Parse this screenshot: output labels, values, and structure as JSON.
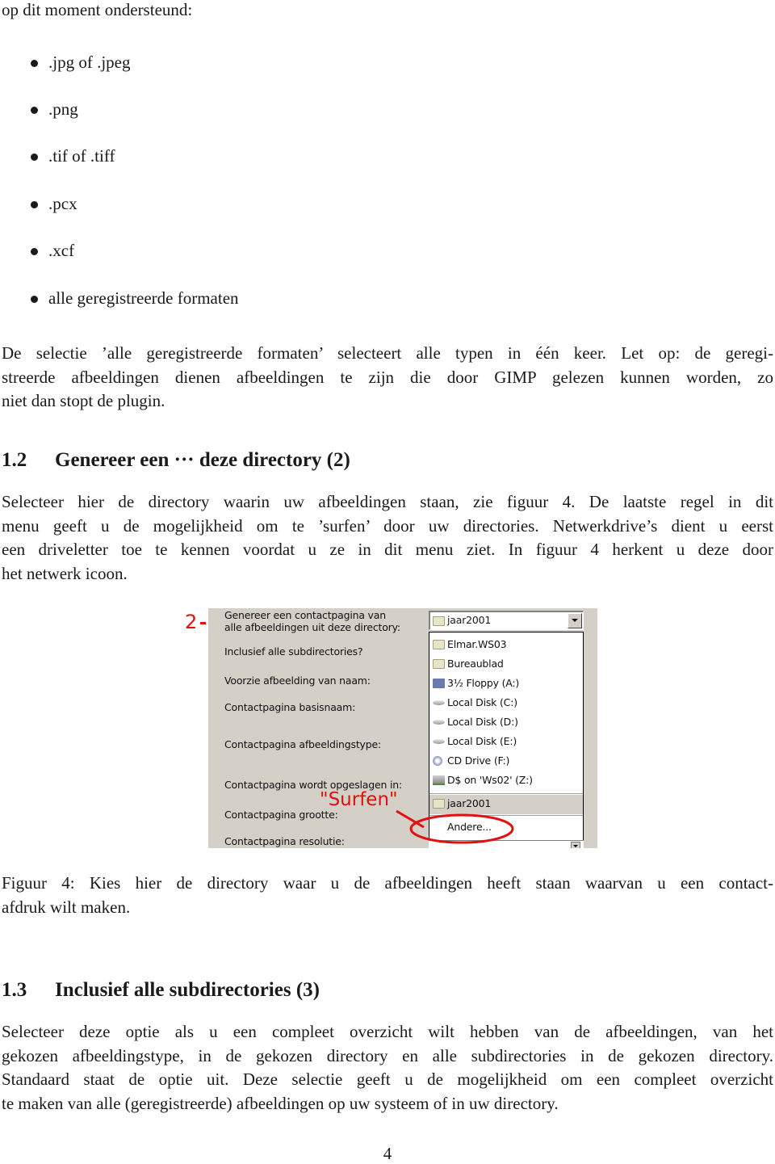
{
  "intro_line": "op dit moment ondersteund:",
  "format_list": [
    ".jpg of .jpeg",
    ".png",
    ".tif of .tiff",
    ".pcx",
    ".xcf",
    "alle geregistreerde formaten"
  ],
  "para1_lines": [
    "De selectie ’alle geregistreerde formaten’ selecteert alle typen in één keer. Let op: de geregi-",
    "streerde afbeeldingen dienen afbeeldingen te zijn die door GIMP gelezen kunnen worden, zo",
    "niet dan stopt de plugin."
  ],
  "section_1_2": {
    "number": "1.2",
    "title": "Genereer een ··· deze directory (2)",
    "para_lines": [
      "Selecteer hier de directory waarin uw afbeeldingen staan, zie figuur 4. De laatste regel in dit",
      "menu geeft u de mogelijkheid om te ’surfen’ door uw directories. Netwerkdrive’s dient u eerst",
      "een driveletter toe te kennen voordat u ze in dit menu ziet. In figuur 4 herkent u deze door",
      "het netwerk icoon."
    ]
  },
  "figure": {
    "annotation_number": "2",
    "annotation_surfen": "\"Surfen\"",
    "annotation_color": "#e01010",
    "dialog_bg": "#d4d0c8",
    "labels": [
      "Genereer een contactpagina van",
      " alle afbeeldingen uit deze directory:",
      "Inclusief alle subdirectories?",
      "Voorzie afbeelding van naam:",
      "Contactpagina basisnaam:",
      "Contactpagina afbeeldingstype:",
      "Contactpagina wordt opgeslagen in:",
      "Contactpagina grootte:",
      "Contactpagina resolutie:"
    ],
    "combo_value": "jaar2001",
    "dropdown_items": [
      {
        "label": "Elmar.WS03",
        "icon": "folder-icon"
      },
      {
        "label": "Bureaublad",
        "icon": "folder-icon"
      },
      {
        "label": "3½ Floppy (A:)",
        "icon": "floppy-icon"
      },
      {
        "label": "Local Disk (C:)",
        "icon": "disk-icon"
      },
      {
        "label": "Local Disk (D:)",
        "icon": "disk-icon"
      },
      {
        "label": "Local Disk (E:)",
        "icon": "disk-icon"
      },
      {
        "label": "CD Drive (F:)",
        "icon": "cd-drive-icon"
      },
      {
        "label": "D$ on 'Ws02' (Z:)",
        "icon": "network-drive-icon"
      },
      {
        "label": "jaar2001",
        "icon": "folder-icon"
      },
      {
        "label": "Andere...",
        "icon": ""
      }
    ]
  },
  "caption_lines": [
    "Figuur 4: Kies hier de directory waar u de afbeeldingen heeft staan waarvan u een contact-",
    "afdruk wilt maken."
  ],
  "section_1_3": {
    "number": "1.3",
    "title": "Inclusief alle subdirectories (3)",
    "para_lines": [
      "Selecteer deze optie als u een compleet overzicht wilt hebben van de afbeeldingen, van het",
      "gekozen afbeeldingstype, in de gekozen directory en alle subdirectories in de gekozen directory.",
      "Standaard staat de optie uit. Deze selectie geeft u de mogelijkheid om een compleet overzicht",
      "te maken van alle (geregistreerde) afbeeldingen op uw systeem of in uw directory."
    ]
  },
  "page_number": "4"
}
